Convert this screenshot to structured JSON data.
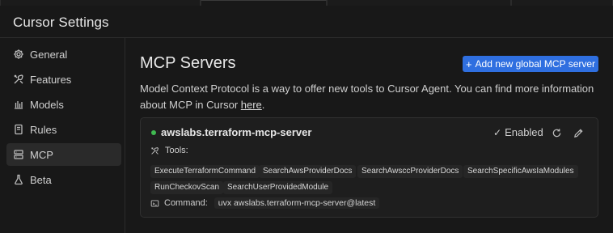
{
  "window": {
    "title": "Cursor Settings"
  },
  "sidebar": {
    "items": [
      {
        "label": "General",
        "icon": "gear-icon"
      },
      {
        "label": "Features",
        "icon": "tools-icon"
      },
      {
        "label": "Models",
        "icon": "bar-chart-icon"
      },
      {
        "label": "Rules",
        "icon": "book-icon"
      },
      {
        "label": "MCP",
        "icon": "server-icon",
        "active": true
      },
      {
        "label": "Beta",
        "icon": "flask-icon"
      }
    ]
  },
  "main": {
    "title": "MCP Servers",
    "add_button_label": "Add new global MCP server",
    "description_text": "Model Context Protocol is a way to offer new tools to Cursor Agent. You can find more information about MCP in Cursor ",
    "description_link": "here",
    "description_end": "."
  },
  "server": {
    "name": "awslabs.terraform-mcp-server",
    "status_color": "#3fb950",
    "enabled_label": "Enabled",
    "tools_label": "Tools:",
    "tools": [
      "ExecuteTerraformCommand",
      "SearchAwsProviderDocs",
      "SearchAwsccProviderDocs",
      "SearchSpecificAwsIaModules",
      "RunCheckovScan",
      "SearchUserProvidedModule"
    ],
    "command_label": "Command:",
    "command_value": "uvx awslabs.terraform-mcp-server@latest"
  },
  "colors": {
    "accent": "#2f6fe0",
    "background": "#181818"
  }
}
